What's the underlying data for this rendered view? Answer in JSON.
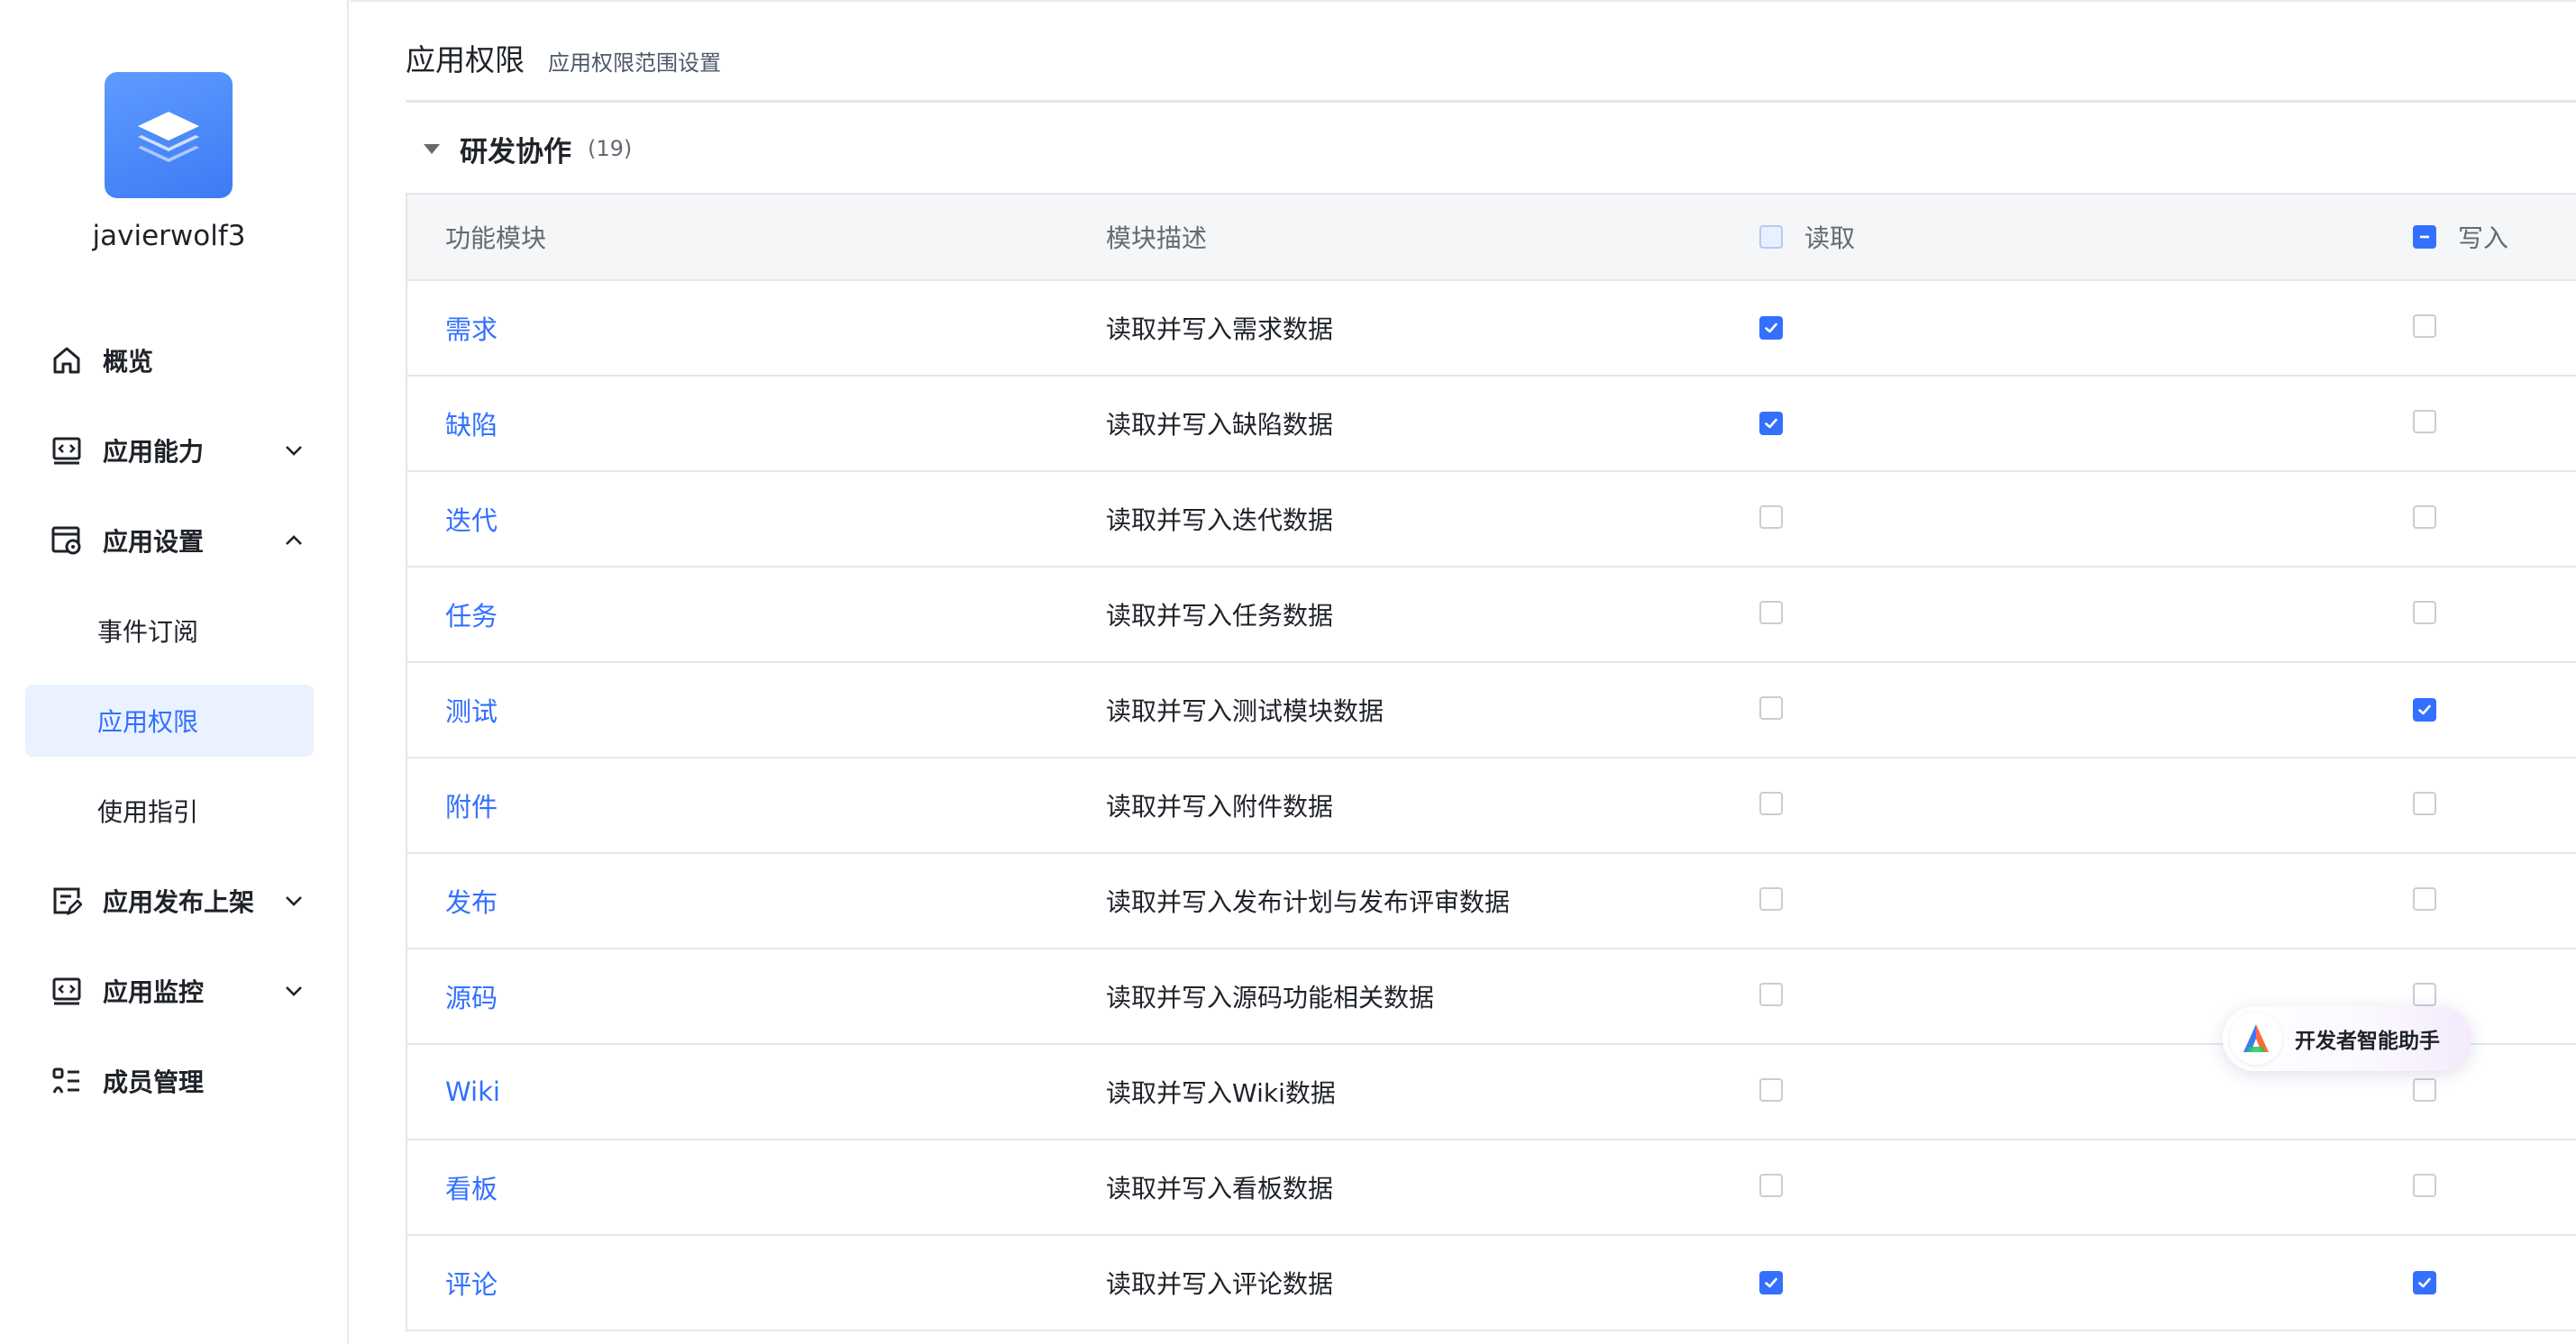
{
  "sidebar": {
    "app_name": "javierwolf3",
    "nav": [
      {
        "label": "概览",
        "icon": "home-icon"
      },
      {
        "label": "应用能力",
        "icon": "code-window-icon",
        "chevron": "down"
      },
      {
        "label": "应用设置",
        "icon": "settings-window-icon",
        "chevron": "up"
      }
    ],
    "sub_items": [
      {
        "label": "事件订阅"
      },
      {
        "label": "应用权限",
        "active": true
      },
      {
        "label": "使用指引"
      }
    ],
    "nav_bottom": [
      {
        "label": "应用发布上架",
        "icon": "publish-icon",
        "chevron": "down"
      },
      {
        "label": "应用监控",
        "icon": "monitor-icon",
        "chevron": "down"
      },
      {
        "label": "成员管理",
        "icon": "member-list-icon"
      }
    ]
  },
  "header": {
    "title": "应用权限",
    "subtitle": "应用权限范围设置"
  },
  "section": {
    "title": "研发协作",
    "count": "(19)"
  },
  "table": {
    "columns": {
      "name": "功能模块",
      "desc": "模块描述",
      "read": "读取",
      "write": "写入"
    },
    "rows": [
      {
        "name": "需求",
        "desc": "读取并写入需求数据",
        "read": true,
        "write": false
      },
      {
        "name": "缺陷",
        "desc": "读取并写入缺陷数据",
        "read": true,
        "write": false
      },
      {
        "name": "迭代",
        "desc": "读取并写入迭代数据",
        "read": false,
        "write": false
      },
      {
        "name": "任务",
        "desc": "读取并写入任务数据",
        "read": false,
        "write": false
      },
      {
        "name": "测试",
        "desc": "读取并写入测试模块数据",
        "read": false,
        "write": true
      },
      {
        "name": "附件",
        "desc": "读取并写入附件数据",
        "read": false,
        "write": false
      },
      {
        "name": "发布",
        "desc": "读取并写入发布计划与发布评审数据",
        "read": false,
        "write": false
      },
      {
        "name": "源码",
        "desc": "读取并写入源码功能相关数据",
        "read": false,
        "write": false
      },
      {
        "name": "Wiki",
        "desc": "读取并写入Wiki数据",
        "read": false,
        "write": false
      },
      {
        "name": "看板",
        "desc": "读取并写入看板数据",
        "read": false,
        "write": false
      },
      {
        "name": "评论",
        "desc": "读取并写入评论数据",
        "read": true,
        "write": true
      }
    ]
  },
  "assistant": {
    "label": "开发者智能助手"
  },
  "colors": {
    "accent": "#3370ff",
    "active_bg": "#eaf1ff",
    "header_bg": "#f5f6f7",
    "border": "#e5e6eb"
  }
}
